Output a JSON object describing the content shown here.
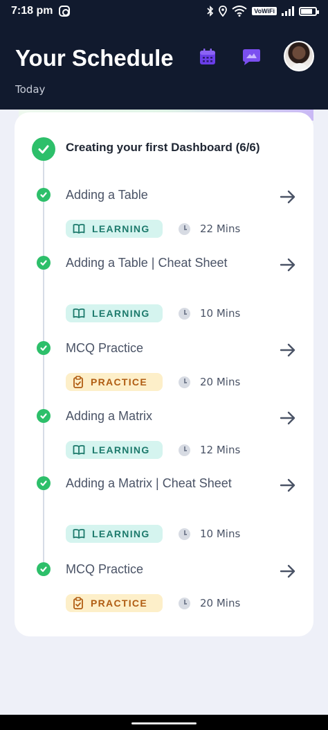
{
  "status_bar": {
    "time": "7:18 pm",
    "vowifi": "VoWiFi"
  },
  "header": {
    "title": "Your Schedule",
    "subtitle": "Today"
  },
  "section": {
    "title": "Creating your first Dashboard (6/6)"
  },
  "items": [
    {
      "label": "Adding a Table",
      "badge": "LEARNING",
      "type": "learning",
      "duration": "22 Mins"
    },
    {
      "label": "Adding a Table | Cheat Sheet",
      "badge": "LEARNING",
      "type": "learning",
      "duration": "10 Mins"
    },
    {
      "label": "MCQ Practice",
      "badge": "PRACTICE",
      "type": "practice",
      "duration": "20 Mins"
    },
    {
      "label": "Adding a Matrix",
      "badge": "LEARNING",
      "type": "learning",
      "duration": "12 Mins"
    },
    {
      "label": "Adding a Matrix | Cheat Sheet",
      "badge": "LEARNING",
      "type": "learning",
      "duration": "10 Mins"
    },
    {
      "label": "MCQ Practice",
      "badge": "PRACTICE",
      "type": "practice",
      "duration": "20 Mins"
    }
  ],
  "colors": {
    "header_bg": "#111a2e",
    "check_green": "#2dbf6a",
    "learning_bg": "#d5f4ef",
    "practice_bg": "#fdefc9",
    "accent_purple": "#7b4ff0"
  }
}
